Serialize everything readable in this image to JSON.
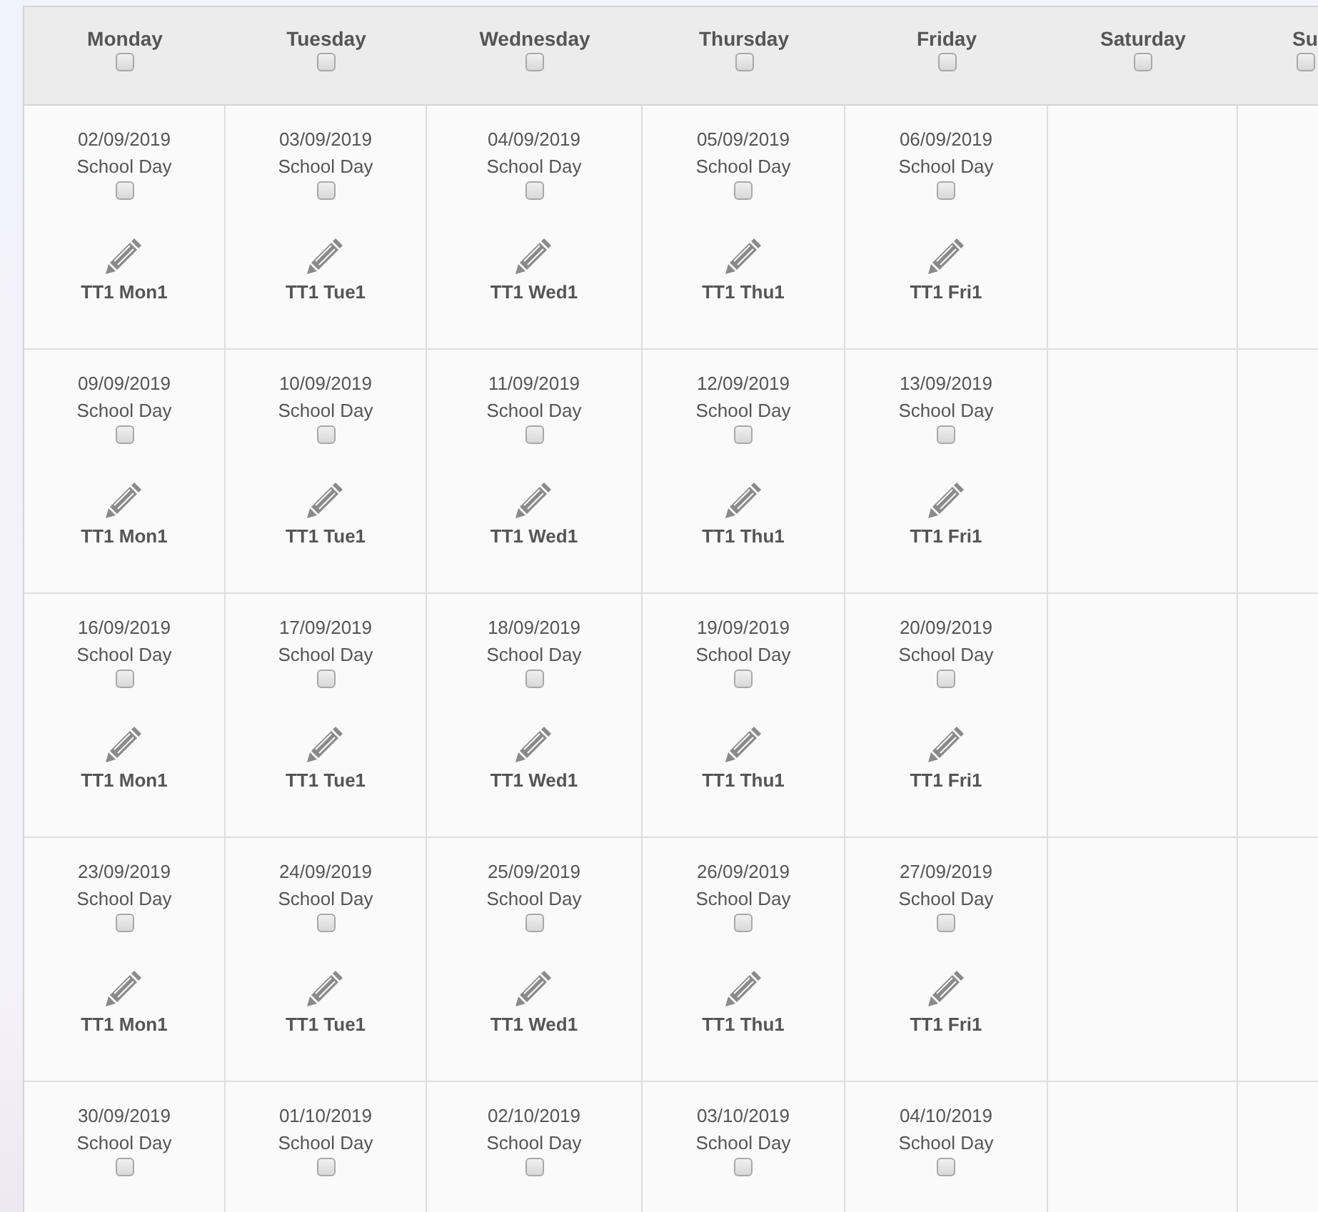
{
  "days": [
    {
      "name": "Monday",
      "checked": false
    },
    {
      "name": "Tuesday",
      "checked": false
    },
    {
      "name": "Wednesday",
      "checked": false
    },
    {
      "name": "Thursday",
      "checked": false
    },
    {
      "name": "Friday",
      "checked": false
    },
    {
      "name": "Saturday",
      "checked": false
    },
    {
      "name": "Su",
      "checked": false
    }
  ],
  "weeks": [
    {
      "cells": [
        {
          "date": "02/09/2019",
          "label": "School Day",
          "checked": false,
          "timetable": "TT1 Mon1"
        },
        {
          "date": "03/09/2019",
          "label": "School Day",
          "checked": false,
          "timetable": "TT1 Tue1"
        },
        {
          "date": "04/09/2019",
          "label": "School Day",
          "checked": false,
          "timetable": "TT1 Wed1"
        },
        {
          "date": "05/09/2019",
          "label": "School Day",
          "checked": false,
          "timetable": "TT1 Thu1"
        },
        {
          "date": "06/09/2019",
          "label": "School Day",
          "checked": false,
          "timetable": "TT1 Fri1"
        },
        {},
        {}
      ]
    },
    {
      "cells": [
        {
          "date": "09/09/2019",
          "label": "School Day",
          "checked": false,
          "timetable": "TT1 Mon1"
        },
        {
          "date": "10/09/2019",
          "label": "School Day",
          "checked": false,
          "timetable": "TT1 Tue1"
        },
        {
          "date": "11/09/2019",
          "label": "School Day",
          "checked": false,
          "timetable": "TT1 Wed1"
        },
        {
          "date": "12/09/2019",
          "label": "School Day",
          "checked": false,
          "timetable": "TT1 Thu1"
        },
        {
          "date": "13/09/2019",
          "label": "School Day",
          "checked": false,
          "timetable": "TT1 Fri1"
        },
        {},
        {}
      ]
    },
    {
      "cells": [
        {
          "date": "16/09/2019",
          "label": "School Day",
          "checked": false,
          "timetable": "TT1 Mon1"
        },
        {
          "date": "17/09/2019",
          "label": "School Day",
          "checked": false,
          "timetable": "TT1 Tue1"
        },
        {
          "date": "18/09/2019",
          "label": "School Day",
          "checked": false,
          "timetable": "TT1 Wed1"
        },
        {
          "date": "19/09/2019",
          "label": "School Day",
          "checked": false,
          "timetable": "TT1 Thu1"
        },
        {
          "date": "20/09/2019",
          "label": "School Day",
          "checked": false,
          "timetable": "TT1 Fri1"
        },
        {},
        {}
      ]
    },
    {
      "cells": [
        {
          "date": "23/09/2019",
          "label": "School Day",
          "checked": false,
          "timetable": "TT1 Mon1"
        },
        {
          "date": "24/09/2019",
          "label": "School Day",
          "checked": false,
          "timetable": "TT1 Tue1"
        },
        {
          "date": "25/09/2019",
          "label": "School Day",
          "checked": false,
          "timetable": "TT1 Wed1"
        },
        {
          "date": "26/09/2019",
          "label": "School Day",
          "checked": false,
          "timetable": "TT1 Thu1"
        },
        {
          "date": "27/09/2019",
          "label": "School Day",
          "checked": false,
          "timetable": "TT1 Fri1"
        },
        {},
        {}
      ]
    },
    {
      "cells": [
        {
          "date": "30/09/2019",
          "label": "School Day",
          "checked": false
        },
        {
          "date": "01/10/2019",
          "label": "School Day",
          "checked": false
        },
        {
          "date": "02/10/2019",
          "label": "School Day",
          "checked": false
        },
        {
          "date": "03/10/2019",
          "label": "School Day",
          "checked": false
        },
        {
          "date": "04/10/2019",
          "label": "School Day",
          "checked": false
        },
        {},
        {}
      ]
    }
  ]
}
